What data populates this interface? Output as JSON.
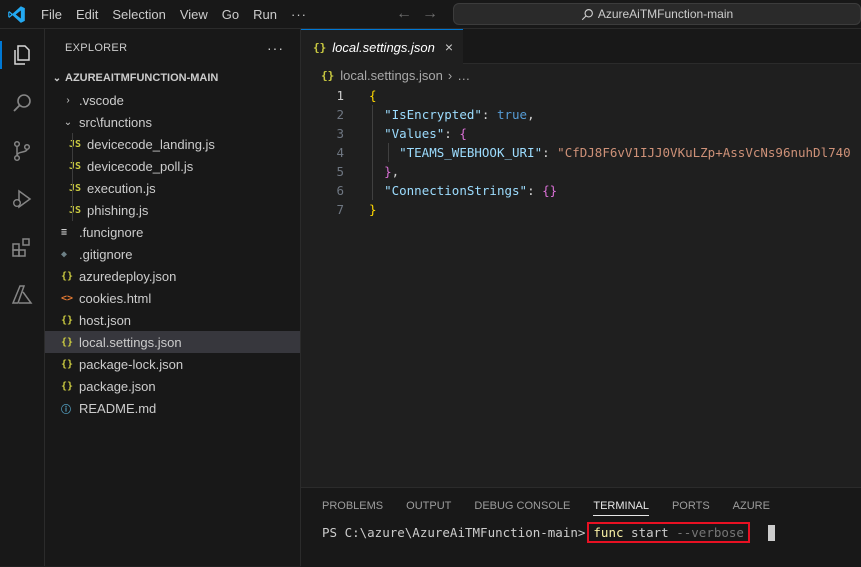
{
  "menu": [
    "File",
    "Edit",
    "Selection",
    "View",
    "Go",
    "Run",
    "···"
  ],
  "search": {
    "text": "AzureAiTMFunction-main"
  },
  "activity_icons": [
    "explorer-icon",
    "search-icon",
    "source-control-icon",
    "run-debug-icon",
    "extensions-icon",
    "azure-icon"
  ],
  "sidebar": {
    "title": "EXPLORER",
    "more": "···",
    "root": "AZUREAITMFUNCTION-MAIN",
    "items": [
      {
        "label": ".vscode",
        "type": "folder-closed",
        "depth": 0
      },
      {
        "label": "src\\functions",
        "type": "folder-open",
        "depth": 0
      },
      {
        "label": "devicecode_landing.js",
        "type": "js",
        "depth": 1
      },
      {
        "label": "devicecode_poll.js",
        "type": "js",
        "depth": 1
      },
      {
        "label": "execution.js",
        "type": "js",
        "depth": 1
      },
      {
        "label": "phishing.js",
        "type": "js",
        "depth": 1
      },
      {
        "label": ".funcignore",
        "type": "lines",
        "depth": 0
      },
      {
        "label": ".gitignore",
        "type": "git",
        "depth": 0
      },
      {
        "label": "azuredeploy.json",
        "type": "json",
        "depth": 0
      },
      {
        "label": "cookies.html",
        "type": "html",
        "depth": 0
      },
      {
        "label": "host.json",
        "type": "json",
        "depth": 0
      },
      {
        "label": "local.settings.json",
        "type": "json",
        "depth": 0,
        "selected": true
      },
      {
        "label": "package-lock.json",
        "type": "json",
        "depth": 0
      },
      {
        "label": "package.json",
        "type": "json",
        "depth": 0
      },
      {
        "label": "README.md",
        "type": "info",
        "depth": 0
      }
    ]
  },
  "editor": {
    "tab": {
      "label": "local.settings.json",
      "close": "×"
    },
    "breadcrumb": {
      "file": "local.settings.json",
      "rest": "…"
    },
    "line_numbers": [
      "1",
      "2",
      "3",
      "4",
      "5",
      "6",
      "7"
    ],
    "code": {
      "k_isencrypted": "\"IsEncrypted\"",
      "v_true": "true",
      "k_values": "\"Values\"",
      "k_webhook": "\"TEAMS_WEBHOOK_URI\"",
      "v_webhook": "\"CfDJ8F6vV1IJJ0VKuLZp+AssVcNs96nuhDl740",
      "k_connstrings": "\"ConnectionStrings\""
    }
  },
  "panel": {
    "tabs": [
      "PROBLEMS",
      "OUTPUT",
      "DEBUG CONSOLE",
      "TERMINAL",
      "PORTS",
      "AZURE"
    ],
    "active_tab": "TERMINAL",
    "prompt": "PS C:\\azure\\AzureAiTMFunction-main>",
    "cmd_func": "func",
    "cmd_start": "start",
    "cmd_flag": "--verbose"
  },
  "colors": {
    "accent": "#0078d4",
    "highlight_box": "#e81123",
    "json_icon": "#cbcb41",
    "js_icon": "#cbcb41",
    "html_icon": "#e37933"
  }
}
